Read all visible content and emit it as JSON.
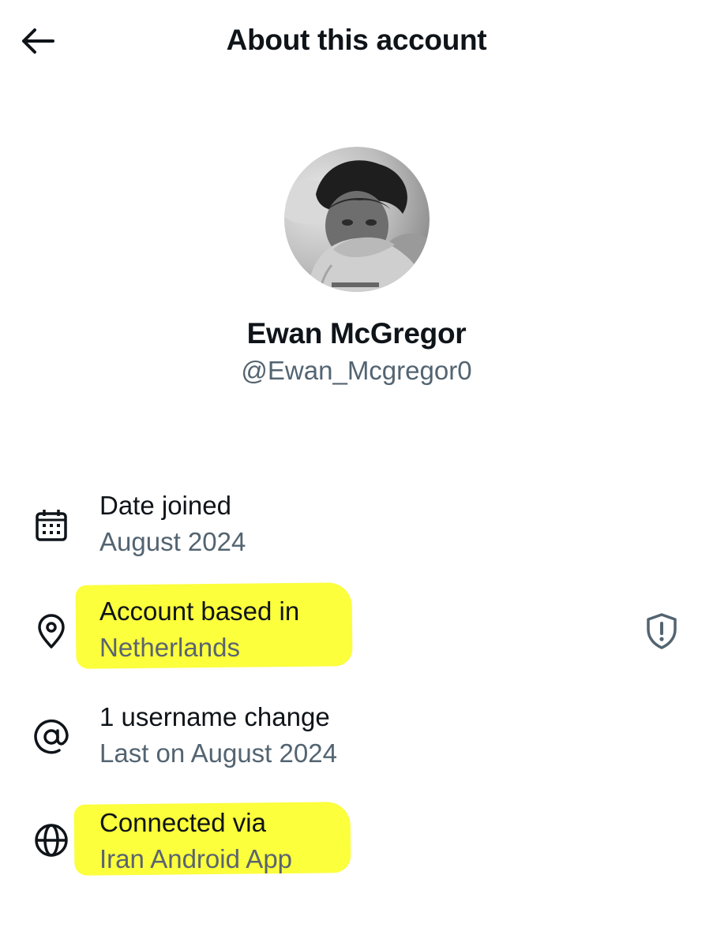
{
  "header": {
    "title": "About this account",
    "back_icon": "arrow-left-icon"
  },
  "profile": {
    "display_name": "Ewan McGregor",
    "handle": "@Ewan_Mcgregor0",
    "avatar_desc": "black-and-white profile photo"
  },
  "details": [
    {
      "icon": "calendar-icon",
      "title": "Date joined",
      "value": "August 2024",
      "highlighted": false
    },
    {
      "icon": "location-pin-icon",
      "title": "Account based in",
      "value": "Netherlands",
      "highlighted": true,
      "trailing_icon": "shield-alert-icon"
    },
    {
      "icon": "at-sign-icon",
      "title": "1 username change",
      "value": "Last on August 2024",
      "highlighted": false
    },
    {
      "icon": "globe-icon",
      "title": "Connected via",
      "value": "Iran Android App",
      "highlighted": true
    }
  ],
  "colors": {
    "text_primary": "#0f1419",
    "text_secondary": "#536471",
    "highlight": "#fcff3c",
    "background": "#ffffff"
  }
}
